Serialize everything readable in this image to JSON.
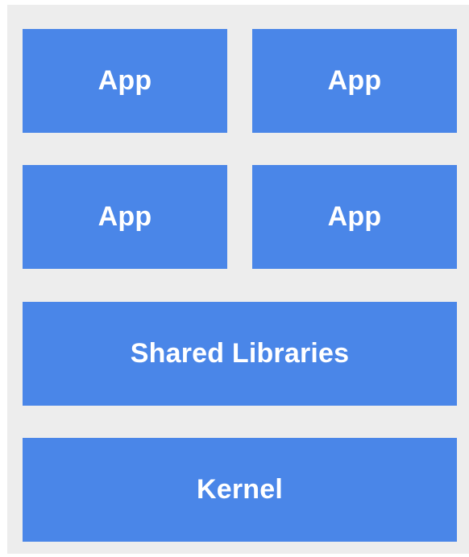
{
  "diagram": {
    "apps": [
      "App",
      "App",
      "App",
      "App"
    ],
    "shared_libraries": "Shared Libraries",
    "kernel": "Kernel"
  },
  "colors": {
    "background": "#ededed",
    "block": "#4a86e8",
    "text": "#ffffff"
  }
}
